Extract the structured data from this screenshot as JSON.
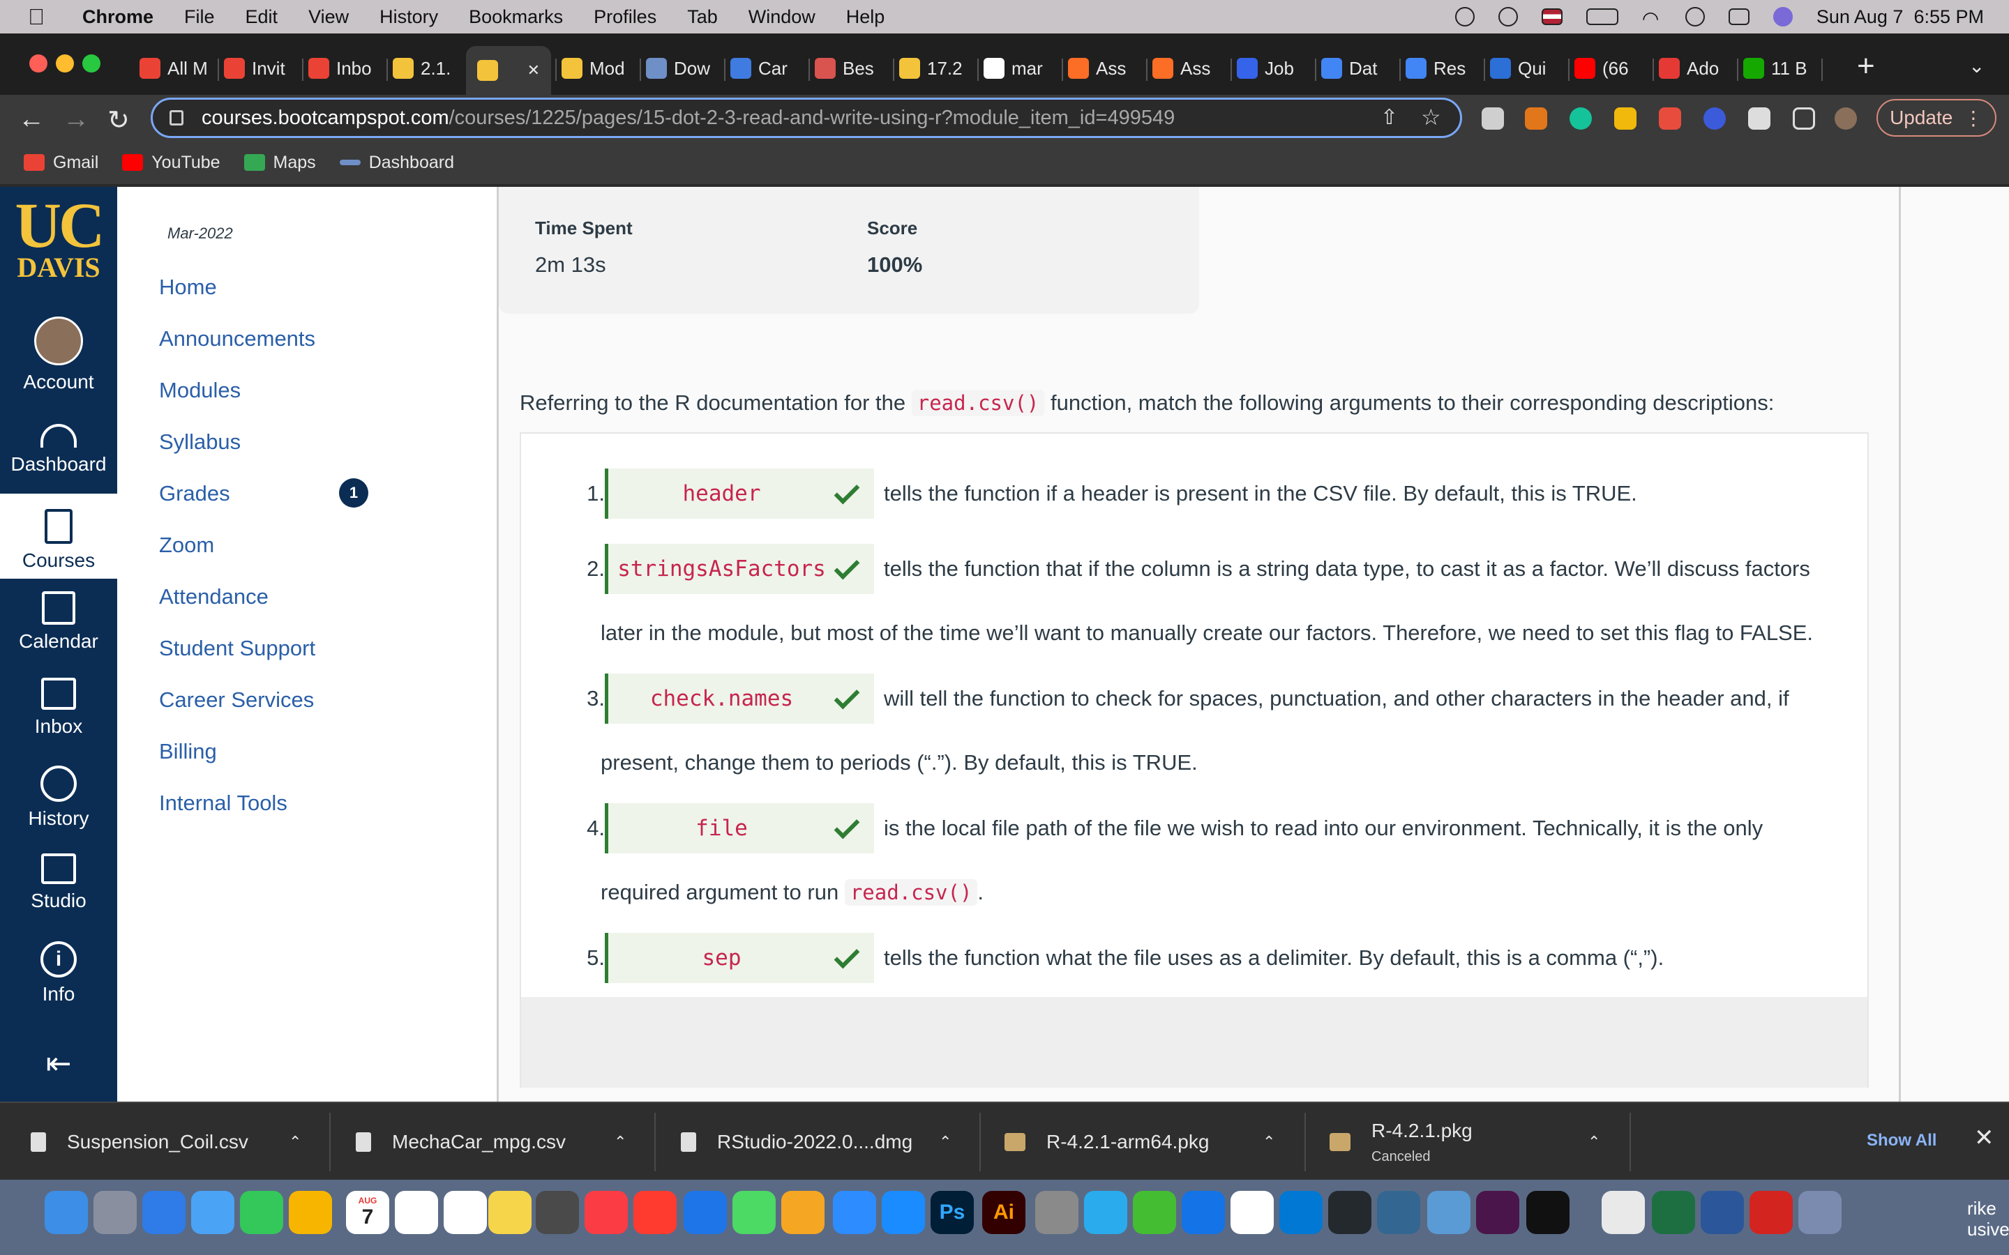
{
  "menubar": {
    "app_name": "Chrome",
    "menus": [
      "File",
      "Edit",
      "View",
      "History",
      "Bookmarks",
      "Profiles",
      "Tab",
      "Window",
      "Help"
    ],
    "datetime": "Sun Aug 7  6:55 PM"
  },
  "tabs": [
    {
      "label": "All M",
      "color": "#ea4335"
    },
    {
      "label": "Invit",
      "color": "#ea4335"
    },
    {
      "label": "Inbo",
      "color": "#ea4335"
    },
    {
      "label": "2.1.",
      "color": "#f3c33b"
    },
    {
      "label": "",
      "color": "#f3c33b",
      "active": true
    },
    {
      "label": "Mod",
      "color": "#f3c33b"
    },
    {
      "label": "Dow",
      "color": "#6f8fc7"
    },
    {
      "label": "Car",
      "color": "#3f7be0"
    },
    {
      "label": "Bes",
      "color": "#d9534f"
    },
    {
      "label": "17.2",
      "color": "#f3c33b"
    },
    {
      "label": "mar",
      "color": "#ffffff"
    },
    {
      "label": "Ass",
      "color": "#fc6d26"
    },
    {
      "label": "Ass",
      "color": "#fc6d26"
    },
    {
      "label": "Job",
      "color": "#3563e9"
    },
    {
      "label": "Dat",
      "color": "#4285f4"
    },
    {
      "label": "Res",
      "color": "#4285f4"
    },
    {
      "label": "Qui",
      "color": "#2c6fd6"
    },
    {
      "label": "(66",
      "color": "#ff0000"
    },
    {
      "label": "Ado",
      "color": "#e53935"
    },
    {
      "label": "11 B",
      "color": "#14a800"
    }
  ],
  "address": {
    "host": "courses.bootcampspot.com",
    "path": "/courses/1225/pages/15-dot-2-3-read-and-write-using-r?module_item_id=499549"
  },
  "update_label": "Update",
  "bookmarks": [
    {
      "label": "Gmail",
      "color": "#ea4335"
    },
    {
      "label": "YouTube",
      "color": "#ff0000"
    },
    {
      "label": "Maps",
      "color": "#34a853"
    },
    {
      "label": "Dashboard",
      "color": "#6f8fc7"
    }
  ],
  "logo": {
    "top": "UC",
    "bottom": "DAVIS"
  },
  "global_nav": [
    "Account",
    "Dashboard",
    "Courses",
    "Calendar",
    "Inbox",
    "History",
    "Studio",
    "Info"
  ],
  "course": {
    "term": "Mar-2022",
    "links": [
      "Home",
      "Announcements",
      "Modules",
      "Syllabus",
      "Grades",
      "Zoom",
      "Attendance",
      "Student Support",
      "Career Services",
      "Billing",
      "Internal Tools"
    ],
    "grades_badge": "1"
  },
  "summary": {
    "time_label": "Time Spent",
    "time_value": "2m 13s",
    "score_label": "Score",
    "score_value": "100%"
  },
  "question": {
    "before": "Referring to the R documentation for the ",
    "code": "read.csv()",
    "after": " function, match the following arguments to their corresponding descriptions:"
  },
  "answers": [
    {
      "num": "1.",
      "arg": "header",
      "line1": "tells the function if a header is present in the CSV file. By default, this is TRUE.",
      "line2": ""
    },
    {
      "num": "2.",
      "arg": "stringsAsFactors",
      "line1": "tells the function that if the column is a string data type, to cast it as a factor. We’ll discuss factors",
      "line2": "later in the module, but most of the time we’ll want to manually create our factors. Therefore, we need to set this flag to FALSE."
    },
    {
      "num": "3.",
      "arg": "check.names",
      "line1": "will tell the function to check for spaces, punctuation, and other characters in the header and, if",
      "line2": "present, change them to periods (“.”). By default, this is TRUE."
    },
    {
      "num": "4.",
      "arg": "file",
      "line1": "is the local file path of the file we wish to read into our environment. Technically, it is the only",
      "line2_before": "required argument to run ",
      "line2_code": "read.csv()",
      "line2_after": "."
    },
    {
      "num": "5.",
      "arg": "sep",
      "line1": "tells the function what the file uses as a delimiter. By default, this is a comma (“,”).",
      "line2": ""
    }
  ],
  "downloads": [
    {
      "name": "Suspension_Coil.csv",
      "status": ""
    },
    {
      "name": "MechaCar_mpg.csv",
      "status": ""
    },
    {
      "name": "RStudio-2022.0....dmg",
      "status": ""
    },
    {
      "name": "R-4.2.1-arm64.pkg",
      "status": ""
    },
    {
      "name": "R-4.2.1.pkg",
      "status": "Canceled"
    }
  ],
  "downloads_show_all": "Show All",
  "dock": {
    "calendar_month": "AUG",
    "calendar_day": "7",
    "ps": "Ps",
    "ai": "Ai",
    "trash_text": "rike\nusive"
  }
}
